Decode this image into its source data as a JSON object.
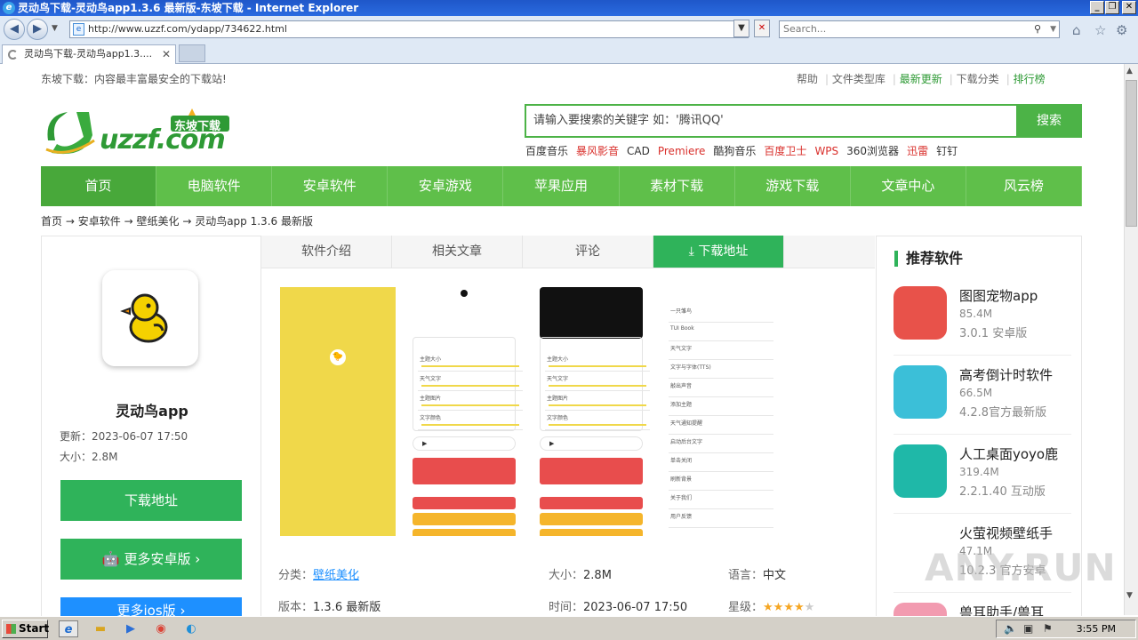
{
  "window": {
    "title": "灵动鸟下载-灵动鸟app1.3.6 最新版-东坡下载 - Internet Explorer",
    "min_label": "_",
    "restore_label": "❐",
    "close_label": "✕"
  },
  "browser": {
    "url": "http://www.uzzf.com/ydapp/734622.html",
    "search_placeholder": "Search...",
    "tab_label": "灵动鸟下载-灵动鸟app1.3....",
    "tab_close": "✕"
  },
  "site": {
    "slogan": "东坡下载：内容最丰富最安全的下载站!",
    "top_links": [
      "帮助",
      "文件类型库",
      "最新更新",
      "下载分类",
      "排行榜"
    ],
    "logo_text": "uzzf.com",
    "logo_badge": "东坡下载",
    "search_placeholder": "请输入要搜索的关键字 如：'腾讯QQ'",
    "search_button": "搜索",
    "hot_words": [
      {
        "text": "百度音乐",
        "red": false
      },
      {
        "text": "暴风影音",
        "red": true
      },
      {
        "text": "CAD",
        "red": false
      },
      {
        "text": "Premiere",
        "red": true
      },
      {
        "text": "酷狗音乐",
        "red": false
      },
      {
        "text": "百度卫士",
        "red": true
      },
      {
        "text": "WPS",
        "red": true
      },
      {
        "text": "360浏览器",
        "red": false
      },
      {
        "text": "迅雷",
        "red": true
      },
      {
        "text": "钉钉",
        "red": false
      }
    ],
    "nav": [
      "首页",
      "电脑软件",
      "安卓软件",
      "安卓游戏",
      "苹果应用",
      "素材下载",
      "游戏下载",
      "文章中心",
      "风云榜"
    ],
    "breadcrumb": [
      "首页",
      "安卓软件",
      "壁纸美化",
      "灵动鸟app 1.3.6 最新版"
    ],
    "breadcrumb_sep": "→"
  },
  "app": {
    "name": "灵动鸟app",
    "updated": "更新：2023-06-07 17:50",
    "size": "大小：2.8M",
    "download_button": "下载地址",
    "more_android": "更多安卓版",
    "more_ios": "更多ios版"
  },
  "detail_tabs": [
    "软件介绍",
    "相关文章",
    "评论",
    "下载地址"
  ],
  "screenshots": {
    "shot2_rows": [
      "主题大小",
      "天气文字",
      "主题图片",
      "文字颜色"
    ],
    "shot3_rows": [
      "主题大小",
      "天气文字",
      "主题图片",
      "文字颜色"
    ],
    "shot4_rows": [
      "一只雏鸟",
      "TUI Book",
      "天气文字",
      "文字与字体(TTS)",
      "敲出声音",
      "添加主题",
      "天气通知提醒",
      "启动后台文字",
      "单击关闭",
      "刷新背景",
      "关于我们",
      "用户反馈"
    ]
  },
  "info": {
    "category_label": "分类：",
    "category_value": "壁纸美化",
    "size_label": "大小：",
    "size_value": "2.8M",
    "lang_label": "语言：",
    "lang_value": "中文",
    "version_label": "版本：",
    "version_value": "1.3.6 最新版",
    "time_label": "时间：",
    "time_value": "2023-06-07 17:50",
    "rating_label": "星级：",
    "rating": 4,
    "rating_max": 5
  },
  "recommend": {
    "title": "推荐软件",
    "items": [
      {
        "name": "图图宠物app",
        "size": "85.4M",
        "version": "3.0.1 安卓版",
        "color": "#e8524a"
      },
      {
        "name": "高考倒计时软件",
        "size": "66.5M",
        "version": "4.2.8官方最新版",
        "color": "#3bbfd8"
      },
      {
        "name": "人工桌面yoyo鹿",
        "size": "319.4M",
        "version": "2.2.1.40 互动版",
        "color": "#1fb8a8"
      },
      {
        "name": "火萤视频壁纸手",
        "size": "47.1M",
        "version": "10.2.3 官方安卓",
        "color": "#ffffff"
      },
      {
        "name": "兽耳助手/兽耳",
        "size": "",
        "version": "",
        "color": "#f29bb0"
      }
    ]
  },
  "watermark": "ANY.RUN",
  "taskbar": {
    "start": "Start",
    "clock": "3:55 PM"
  }
}
